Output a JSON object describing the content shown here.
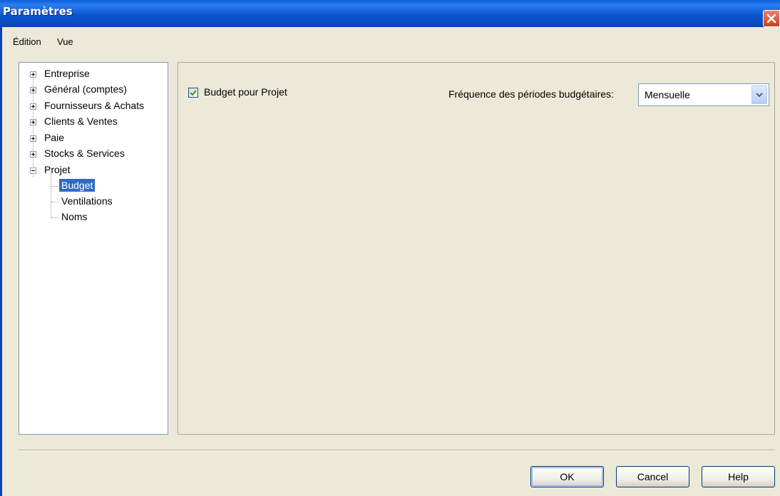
{
  "window": {
    "title": "Paramètres"
  },
  "menu": {
    "items": [
      "Édition",
      "Vue"
    ]
  },
  "tree": {
    "items": [
      {
        "label": "Entreprise",
        "expanded": false
      },
      {
        "label": "Général (comptes)",
        "expanded": false
      },
      {
        "label": "Fournisseurs & Achats",
        "expanded": false
      },
      {
        "label": "Clients & Ventes",
        "expanded": false
      },
      {
        "label": "Paie",
        "expanded": false
      },
      {
        "label": "Stocks & Services",
        "expanded": false
      },
      {
        "label": "Projet",
        "expanded": true
      }
    ],
    "children": [
      {
        "label": "Budget",
        "selected": true
      },
      {
        "label": "Ventilations",
        "selected": false
      },
      {
        "label": "Noms",
        "selected": false
      }
    ]
  },
  "content": {
    "budget_checkbox": {
      "label": "Budget pour Projet",
      "checked": true
    },
    "frequency": {
      "label": "Fréquence des périodes budgétaires:",
      "value": "Mensuelle"
    }
  },
  "buttons": {
    "ok": "OK",
    "cancel": "Cancel",
    "help": "Help"
  },
  "colors": {
    "titlebar": "#0a56d0",
    "selection": "#316ac5",
    "close": "#c8401c"
  }
}
